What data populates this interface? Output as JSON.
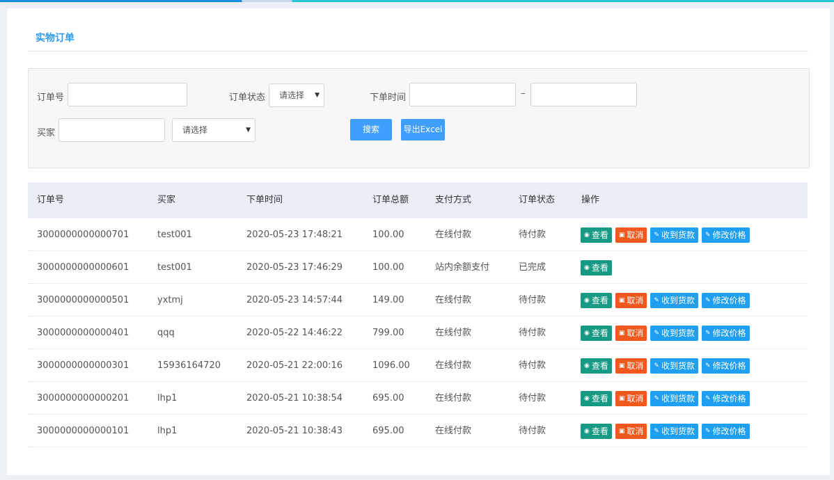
{
  "page": {
    "title": "实物订单"
  },
  "filters": {
    "order_no_label": "订单号",
    "status_label": "订单状态",
    "status_value": "请选择",
    "time_label": "下单时间",
    "range_sep": "–",
    "buyer_label": "买家",
    "buyer_select_value": "请选择",
    "search_button": "搜索",
    "export_button": "导出Excel"
  },
  "table": {
    "headers": [
      "订单号",
      "买家",
      "下单时间",
      "订单总额",
      "支付方式",
      "订单状态",
      "操作"
    ],
    "actions": {
      "view": "查看",
      "cancel": "取消",
      "receive": "收到货款",
      "price": "修改价格"
    },
    "rows": [
      {
        "order_no": "3000000000000701",
        "buyer": "test001",
        "time": "2020-05-23 17:48:21",
        "total": "100.00",
        "pay": "在线付款",
        "status": "待付款",
        "full_actions": true
      },
      {
        "order_no": "3000000000000601",
        "buyer": "test001",
        "time": "2020-05-23 17:46:29",
        "total": "100.00",
        "pay": "站内余额支付",
        "status": "已完成",
        "full_actions": false
      },
      {
        "order_no": "3000000000000501",
        "buyer": "yxtmj",
        "time": "2020-05-23 14:57:44",
        "total": "149.00",
        "pay": "在线付款",
        "status": "待付款",
        "full_actions": true
      },
      {
        "order_no": "3000000000000401",
        "buyer": "qqq",
        "time": "2020-05-22 14:46:22",
        "total": "799.00",
        "pay": "在线付款",
        "status": "待付款",
        "full_actions": true
      },
      {
        "order_no": "3000000000000301",
        "buyer": "15936164720",
        "time": "2020-05-21 22:00:16",
        "total": "1096.00",
        "pay": "在线付款",
        "status": "待付款",
        "full_actions": true
      },
      {
        "order_no": "3000000000000201",
        "buyer": "lhp1",
        "time": "2020-05-21 10:38:54",
        "total": "695.00",
        "pay": "在线付款",
        "status": "待付款",
        "full_actions": true
      },
      {
        "order_no": "3000000000000101",
        "buyer": "lhp1",
        "time": "2020-05-21 10:38:43",
        "total": "695.00",
        "pay": "在线付款",
        "status": "待付款",
        "full_actions": true
      }
    ]
  },
  "colors": {
    "title": "#2e9cf0",
    "view_button": "#169a84",
    "cancel_button": "#f0581e",
    "receive_button": "#1e9ff2",
    "price_button": "#1e9ff2",
    "search_button": "#409eff",
    "header_bg": "#e9eef7"
  },
  "icons": {
    "view": "eye-icon",
    "cancel": "trash-icon",
    "receive": "edit-icon",
    "price": "edit-icon",
    "select": "caret-down-icon"
  }
}
